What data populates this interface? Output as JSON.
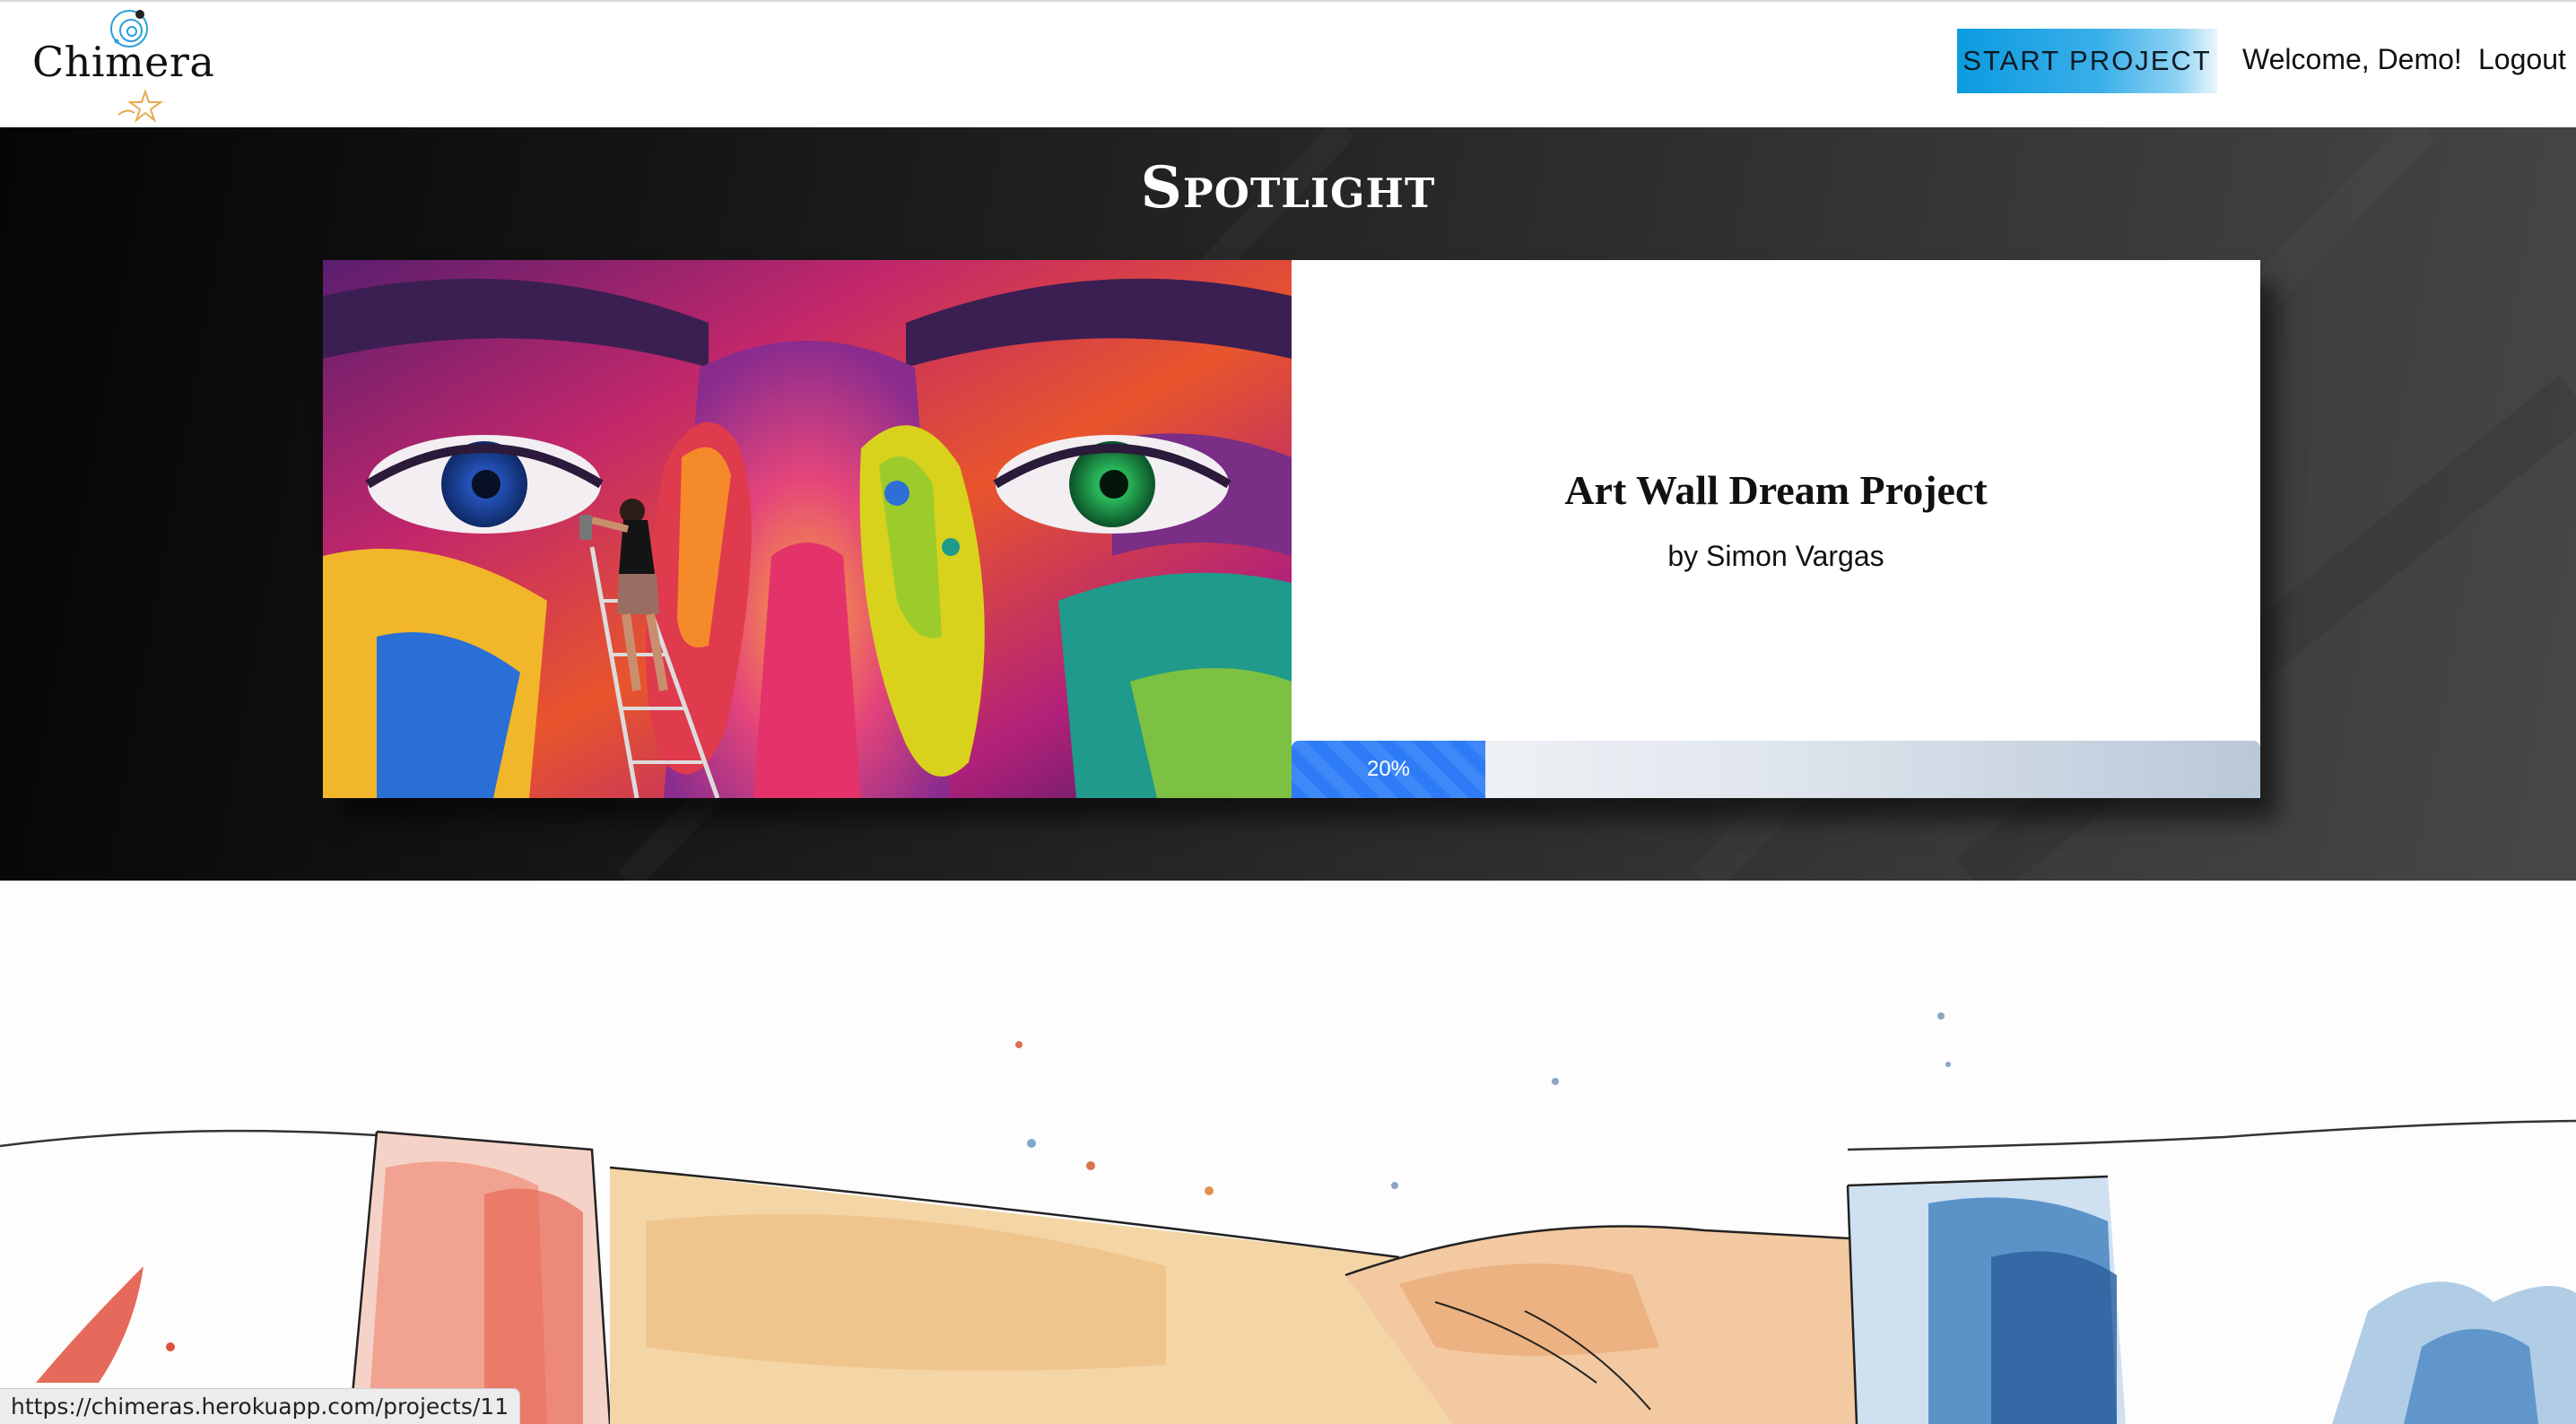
{
  "header": {
    "logo_text": "Chimera",
    "start_project_label": "START PROJECT",
    "welcome_text": "Welcome, Demo!",
    "logout_label": "Logout"
  },
  "spotlight": {
    "heading": "Spotlight",
    "project": {
      "title": "Art Wall Dream Project",
      "author": "by Simon Vargas",
      "progress_percent": 20,
      "progress_label": "20%"
    }
  },
  "status_bar": {
    "url": "https://chimeras.herokuapp.com/projects/11"
  },
  "icons": {
    "logo": "chimera-swirl-star-logo"
  },
  "colors": {
    "accent_button": "#0b9be0",
    "progress_fill": "#2d7bf6"
  }
}
